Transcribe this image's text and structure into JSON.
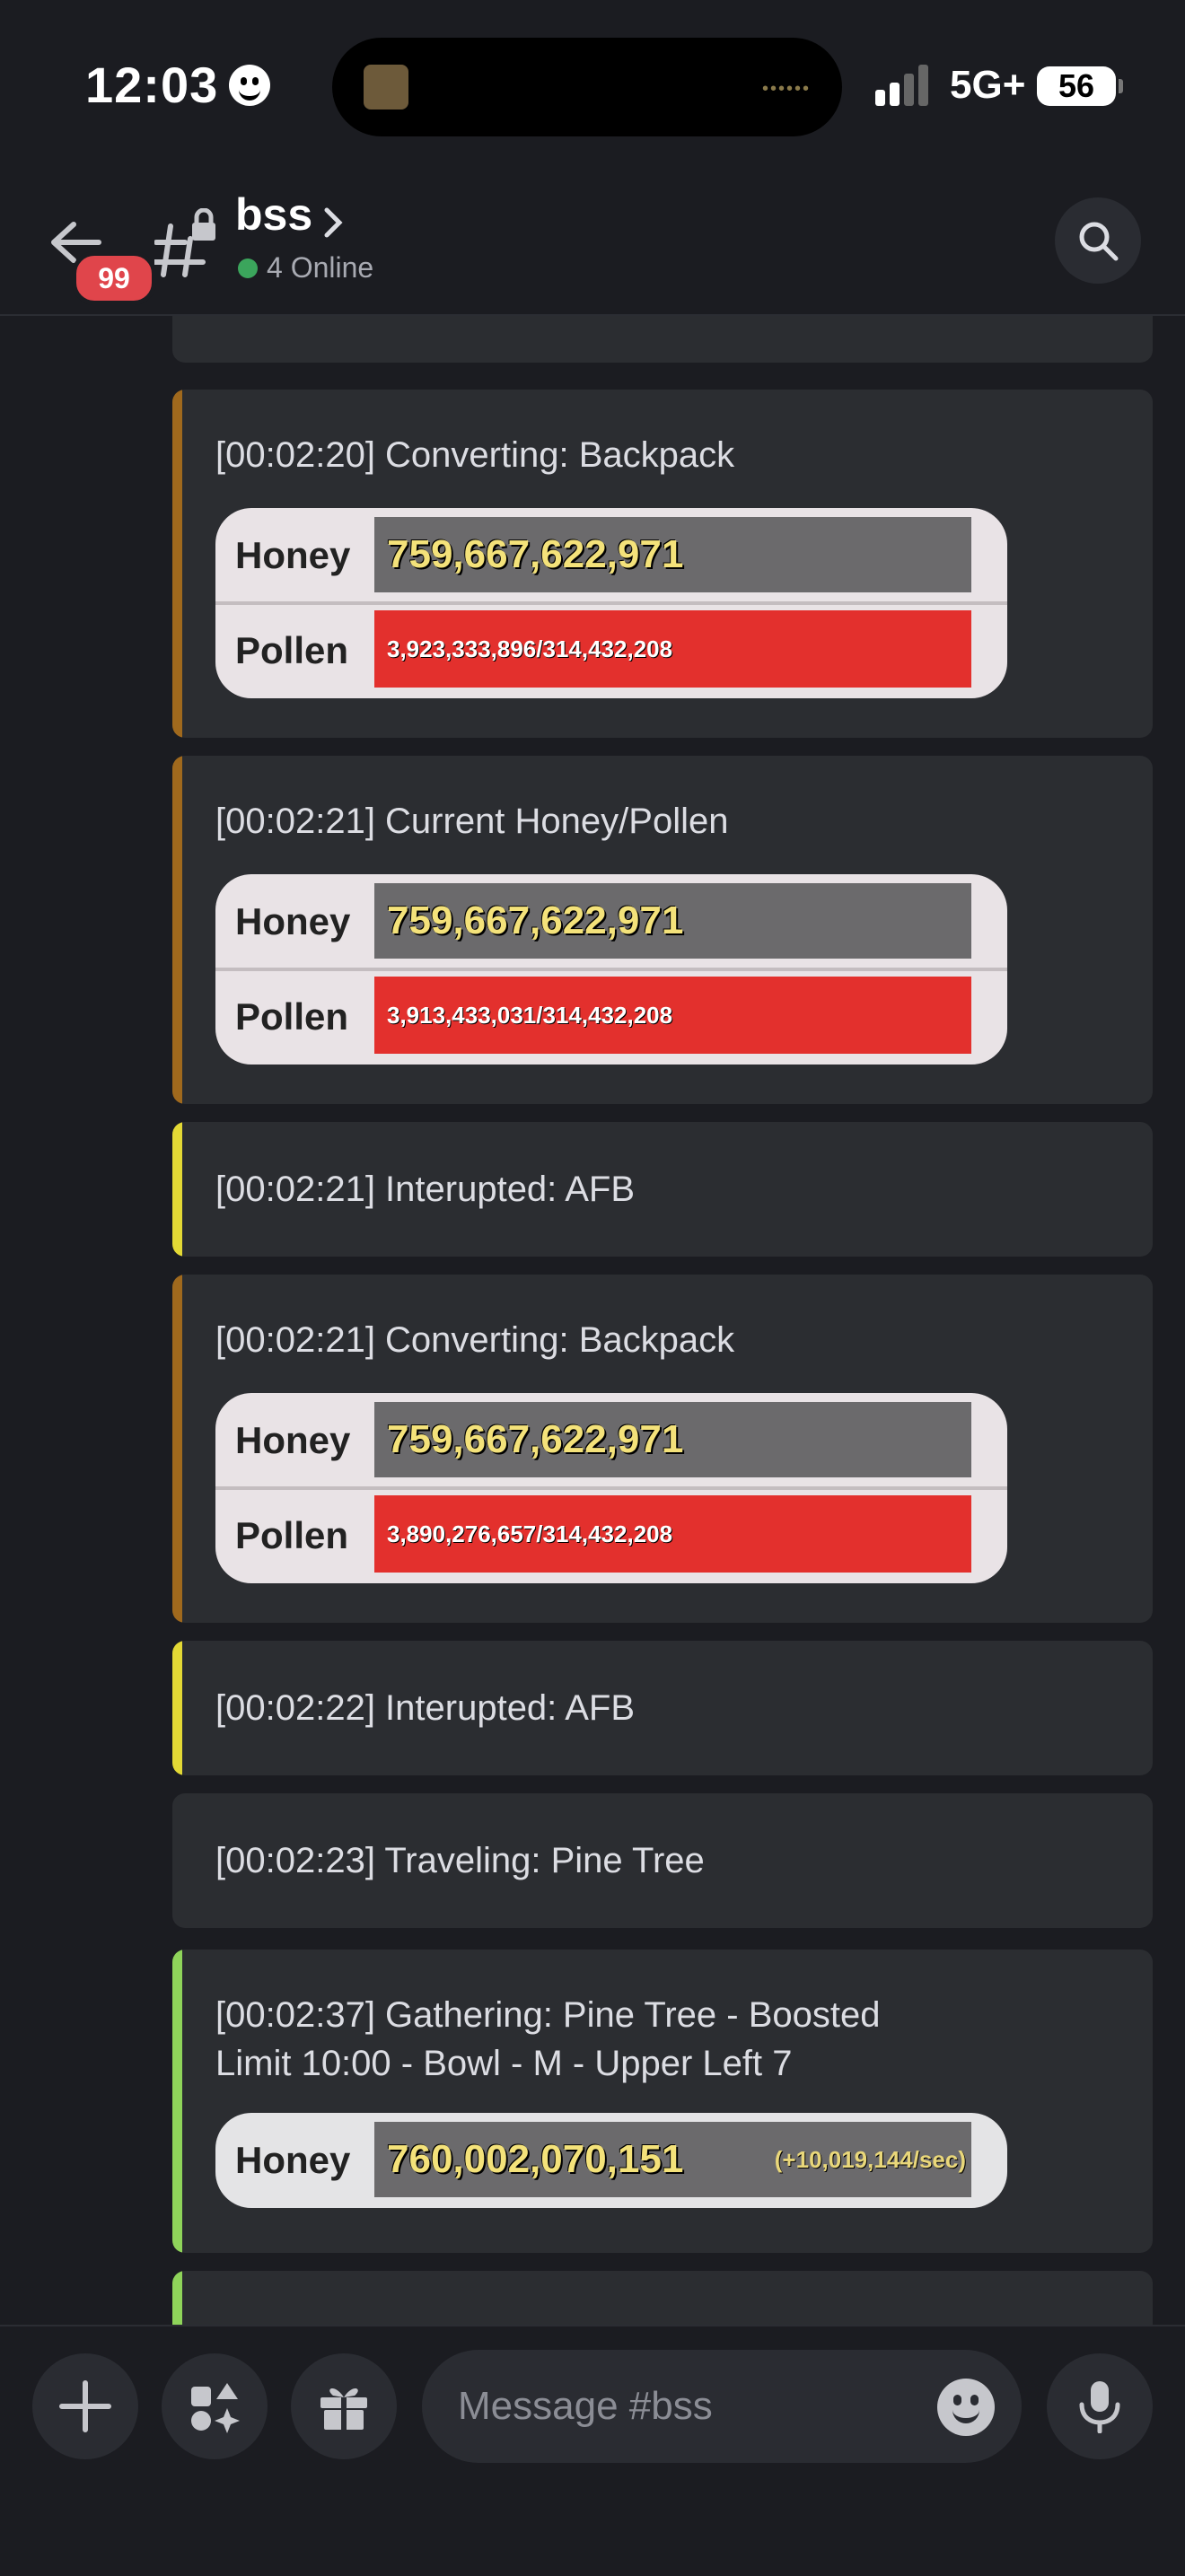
{
  "status_bar": {
    "time": "12:03",
    "network": "5G+",
    "battery": "56"
  },
  "header": {
    "channel_name": "bss",
    "online": "4 Online",
    "unread_badge": "99"
  },
  "messages": [
    {
      "text": "[00:02:20] Converting: Backpack",
      "accent": "#a0691d",
      "honey_label": "Honey",
      "honey": "759,667,622,971",
      "pollen_label": "Pollen",
      "pollen": "3,923,333,896/314,432,208"
    },
    {
      "text": "[00:02:21] Current Honey/Pollen",
      "accent": "#a0691d",
      "honey_label": "Honey",
      "honey": "759,667,622,971",
      "pollen_label": "Pollen",
      "pollen": "3,913,433,031/314,432,208"
    },
    {
      "text": "[00:02:21] Interupted: AFB",
      "accent": "#e3d935"
    },
    {
      "text": "[00:02:21] Converting: Backpack",
      "accent": "#a0691d",
      "honey_label": "Honey",
      "honey": "759,667,622,971",
      "pollen_label": "Pollen",
      "pollen": "3,890,276,657/314,432,208"
    },
    {
      "text": "[00:02:22] Interupted: AFB",
      "accent": "#e3d935"
    },
    {
      "text": "[00:02:23] Traveling: Pine Tree"
    },
    {
      "text": "[00:02:37] Gathering: Pine Tree - Boosted\nLimit 10:00 - Bowl - M - Upper Left 7",
      "accent": "#8fd45a",
      "honey_label": "Honey",
      "honey": "760,002,070,151",
      "honey_rate": "(+10,019,144/sec)"
    }
  ],
  "composer": {
    "placeholder": "Message #bss"
  },
  "colors": {
    "background": "#1b1c21",
    "message_bg": "#2b2d31",
    "online": "#3ba55c",
    "badge": "#e0454b",
    "pollen_bar": "#e3302d"
  }
}
